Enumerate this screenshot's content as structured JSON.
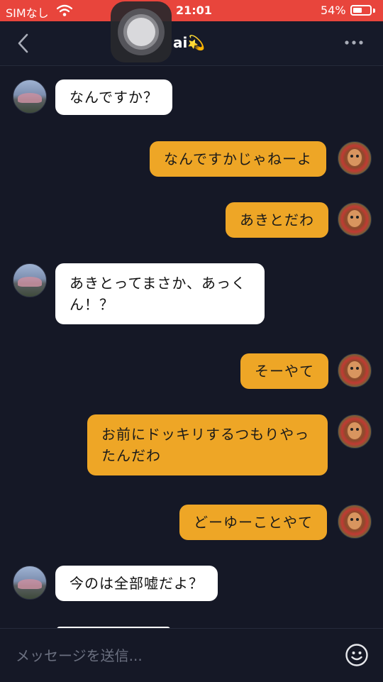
{
  "status_bar": {
    "carrier": "SIMなし",
    "time": "21:01",
    "battery_percent": "54%",
    "battery_level": 0.54,
    "icons": [
      "wifi-icon",
      "battery-icon"
    ]
  },
  "header": {
    "title": "ai💫",
    "icons": [
      "back-chevron-icon",
      "more-dots-icon"
    ]
  },
  "messages": [
    {
      "side": "left",
      "text": "なんですか？"
    },
    {
      "side": "right",
      "text": "なんですかじゃねーよ"
    },
    {
      "side": "right",
      "text": "あきとだわ"
    },
    {
      "side": "left",
      "text": "あきとってまさか、あっくん！？"
    },
    {
      "side": "right",
      "text": "そーやて"
    },
    {
      "side": "right",
      "text": "お前にドッキリするつもりやったんだわ"
    },
    {
      "side": "right",
      "text": "どーゆーことやて"
    },
    {
      "side": "left",
      "text": "今のは全部嘘だよ？"
    }
  ],
  "input": {
    "placeholder": "メッセージを送信..."
  },
  "colors": {
    "background": "#151826",
    "status_bar": "#e8453c",
    "own_bubble": "#eea626",
    "other_bubble": "#ffffff"
  }
}
